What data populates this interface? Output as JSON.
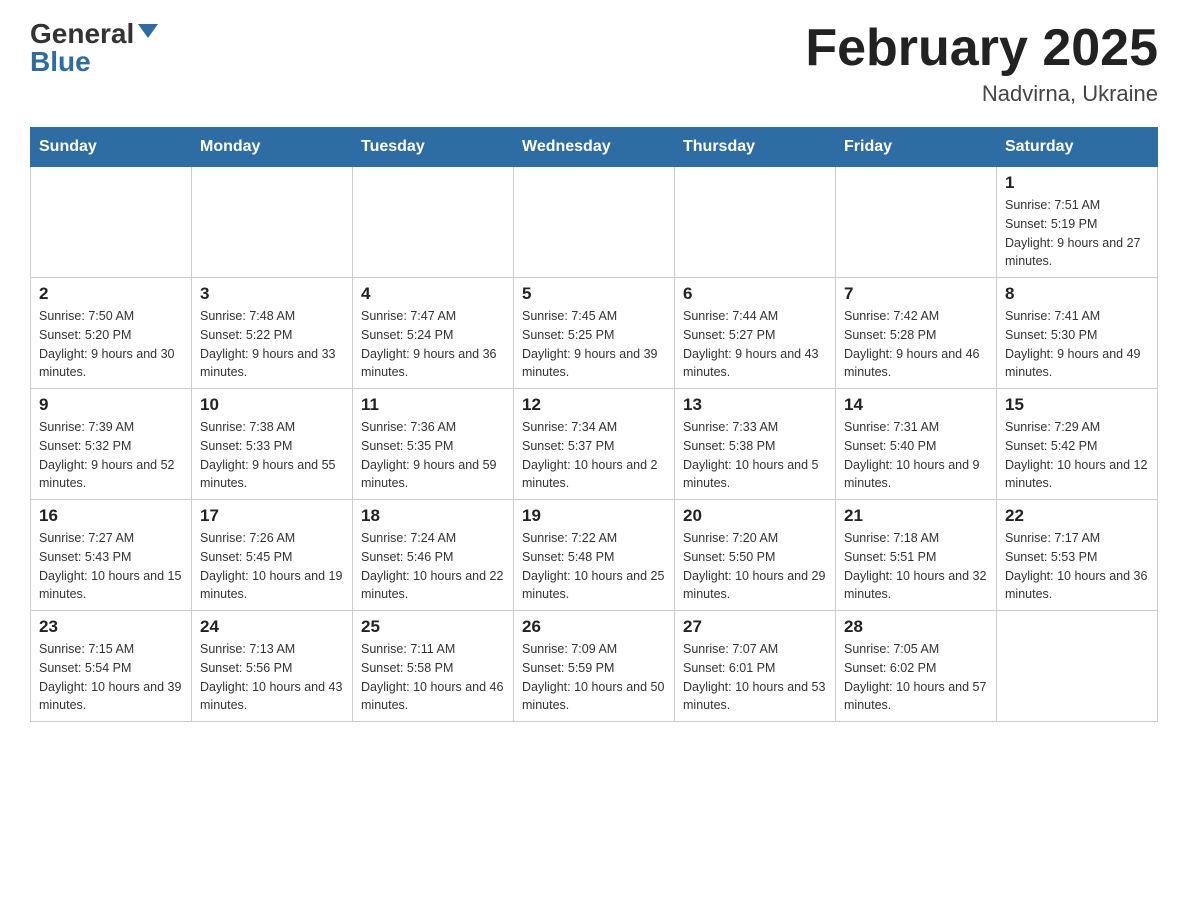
{
  "header": {
    "logo_general": "General",
    "logo_blue": "Blue",
    "month_title": "February 2025",
    "location": "Nadvirna, Ukraine"
  },
  "days_of_week": [
    "Sunday",
    "Monday",
    "Tuesday",
    "Wednesday",
    "Thursday",
    "Friday",
    "Saturday"
  ],
  "weeks": [
    {
      "days": [
        {
          "num": "",
          "info": ""
        },
        {
          "num": "",
          "info": ""
        },
        {
          "num": "",
          "info": ""
        },
        {
          "num": "",
          "info": ""
        },
        {
          "num": "",
          "info": ""
        },
        {
          "num": "",
          "info": ""
        },
        {
          "num": "1",
          "info": "Sunrise: 7:51 AM\nSunset: 5:19 PM\nDaylight: 9 hours and 27 minutes."
        }
      ]
    },
    {
      "days": [
        {
          "num": "2",
          "info": "Sunrise: 7:50 AM\nSunset: 5:20 PM\nDaylight: 9 hours and 30 minutes."
        },
        {
          "num": "3",
          "info": "Sunrise: 7:48 AM\nSunset: 5:22 PM\nDaylight: 9 hours and 33 minutes."
        },
        {
          "num": "4",
          "info": "Sunrise: 7:47 AM\nSunset: 5:24 PM\nDaylight: 9 hours and 36 minutes."
        },
        {
          "num": "5",
          "info": "Sunrise: 7:45 AM\nSunset: 5:25 PM\nDaylight: 9 hours and 39 minutes."
        },
        {
          "num": "6",
          "info": "Sunrise: 7:44 AM\nSunset: 5:27 PM\nDaylight: 9 hours and 43 minutes."
        },
        {
          "num": "7",
          "info": "Sunrise: 7:42 AM\nSunset: 5:28 PM\nDaylight: 9 hours and 46 minutes."
        },
        {
          "num": "8",
          "info": "Sunrise: 7:41 AM\nSunset: 5:30 PM\nDaylight: 9 hours and 49 minutes."
        }
      ]
    },
    {
      "days": [
        {
          "num": "9",
          "info": "Sunrise: 7:39 AM\nSunset: 5:32 PM\nDaylight: 9 hours and 52 minutes."
        },
        {
          "num": "10",
          "info": "Sunrise: 7:38 AM\nSunset: 5:33 PM\nDaylight: 9 hours and 55 minutes."
        },
        {
          "num": "11",
          "info": "Sunrise: 7:36 AM\nSunset: 5:35 PM\nDaylight: 9 hours and 59 minutes."
        },
        {
          "num": "12",
          "info": "Sunrise: 7:34 AM\nSunset: 5:37 PM\nDaylight: 10 hours and 2 minutes."
        },
        {
          "num": "13",
          "info": "Sunrise: 7:33 AM\nSunset: 5:38 PM\nDaylight: 10 hours and 5 minutes."
        },
        {
          "num": "14",
          "info": "Sunrise: 7:31 AM\nSunset: 5:40 PM\nDaylight: 10 hours and 9 minutes."
        },
        {
          "num": "15",
          "info": "Sunrise: 7:29 AM\nSunset: 5:42 PM\nDaylight: 10 hours and 12 minutes."
        }
      ]
    },
    {
      "days": [
        {
          "num": "16",
          "info": "Sunrise: 7:27 AM\nSunset: 5:43 PM\nDaylight: 10 hours and 15 minutes."
        },
        {
          "num": "17",
          "info": "Sunrise: 7:26 AM\nSunset: 5:45 PM\nDaylight: 10 hours and 19 minutes."
        },
        {
          "num": "18",
          "info": "Sunrise: 7:24 AM\nSunset: 5:46 PM\nDaylight: 10 hours and 22 minutes."
        },
        {
          "num": "19",
          "info": "Sunrise: 7:22 AM\nSunset: 5:48 PM\nDaylight: 10 hours and 25 minutes."
        },
        {
          "num": "20",
          "info": "Sunrise: 7:20 AM\nSunset: 5:50 PM\nDaylight: 10 hours and 29 minutes."
        },
        {
          "num": "21",
          "info": "Sunrise: 7:18 AM\nSunset: 5:51 PM\nDaylight: 10 hours and 32 minutes."
        },
        {
          "num": "22",
          "info": "Sunrise: 7:17 AM\nSunset: 5:53 PM\nDaylight: 10 hours and 36 minutes."
        }
      ]
    },
    {
      "days": [
        {
          "num": "23",
          "info": "Sunrise: 7:15 AM\nSunset: 5:54 PM\nDaylight: 10 hours and 39 minutes."
        },
        {
          "num": "24",
          "info": "Sunrise: 7:13 AM\nSunset: 5:56 PM\nDaylight: 10 hours and 43 minutes."
        },
        {
          "num": "25",
          "info": "Sunrise: 7:11 AM\nSunset: 5:58 PM\nDaylight: 10 hours and 46 minutes."
        },
        {
          "num": "26",
          "info": "Sunrise: 7:09 AM\nSunset: 5:59 PM\nDaylight: 10 hours and 50 minutes."
        },
        {
          "num": "27",
          "info": "Sunrise: 7:07 AM\nSunset: 6:01 PM\nDaylight: 10 hours and 53 minutes."
        },
        {
          "num": "28",
          "info": "Sunrise: 7:05 AM\nSunset: 6:02 PM\nDaylight: 10 hours and 57 minutes."
        },
        {
          "num": "",
          "info": ""
        }
      ]
    }
  ]
}
